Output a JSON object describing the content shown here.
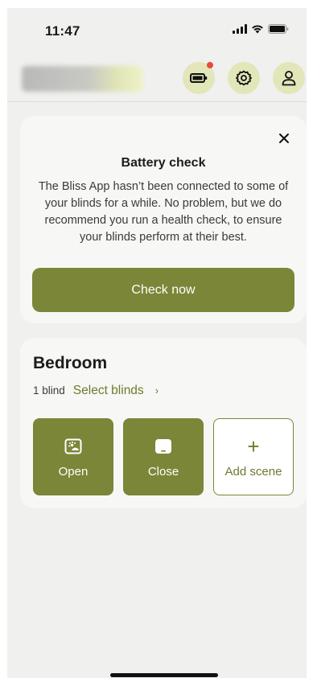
{
  "status_bar": {
    "time": "11:47"
  },
  "header": {
    "icons": [
      "battery-icon",
      "settings-icon",
      "profile-icon"
    ],
    "notification_color": "#e84b3c"
  },
  "battery_card": {
    "title": "Battery check",
    "body": "The Bliss App hasn’t been connected to some of your blinds for a while. No problem, but we do recommend you run a health check, to ensure your blinds perform at their best.",
    "button_label": "Check now"
  },
  "room": {
    "name": "Bedroom",
    "blind_count": "1 blind",
    "select_label": "Select blinds",
    "chevron": "›",
    "scenes": [
      {
        "label": "Open",
        "icon": "open-blind-icon"
      },
      {
        "label": "Close",
        "icon": "close-blind-icon"
      },
      {
        "label": "Add scene",
        "icon": "plus-icon",
        "symbol": "+"
      }
    ]
  },
  "colors": {
    "accent": "#7b8638",
    "accent_light": "#e3e6b9",
    "background": "#f0f0ee",
    "card": "#f7f7f5"
  }
}
